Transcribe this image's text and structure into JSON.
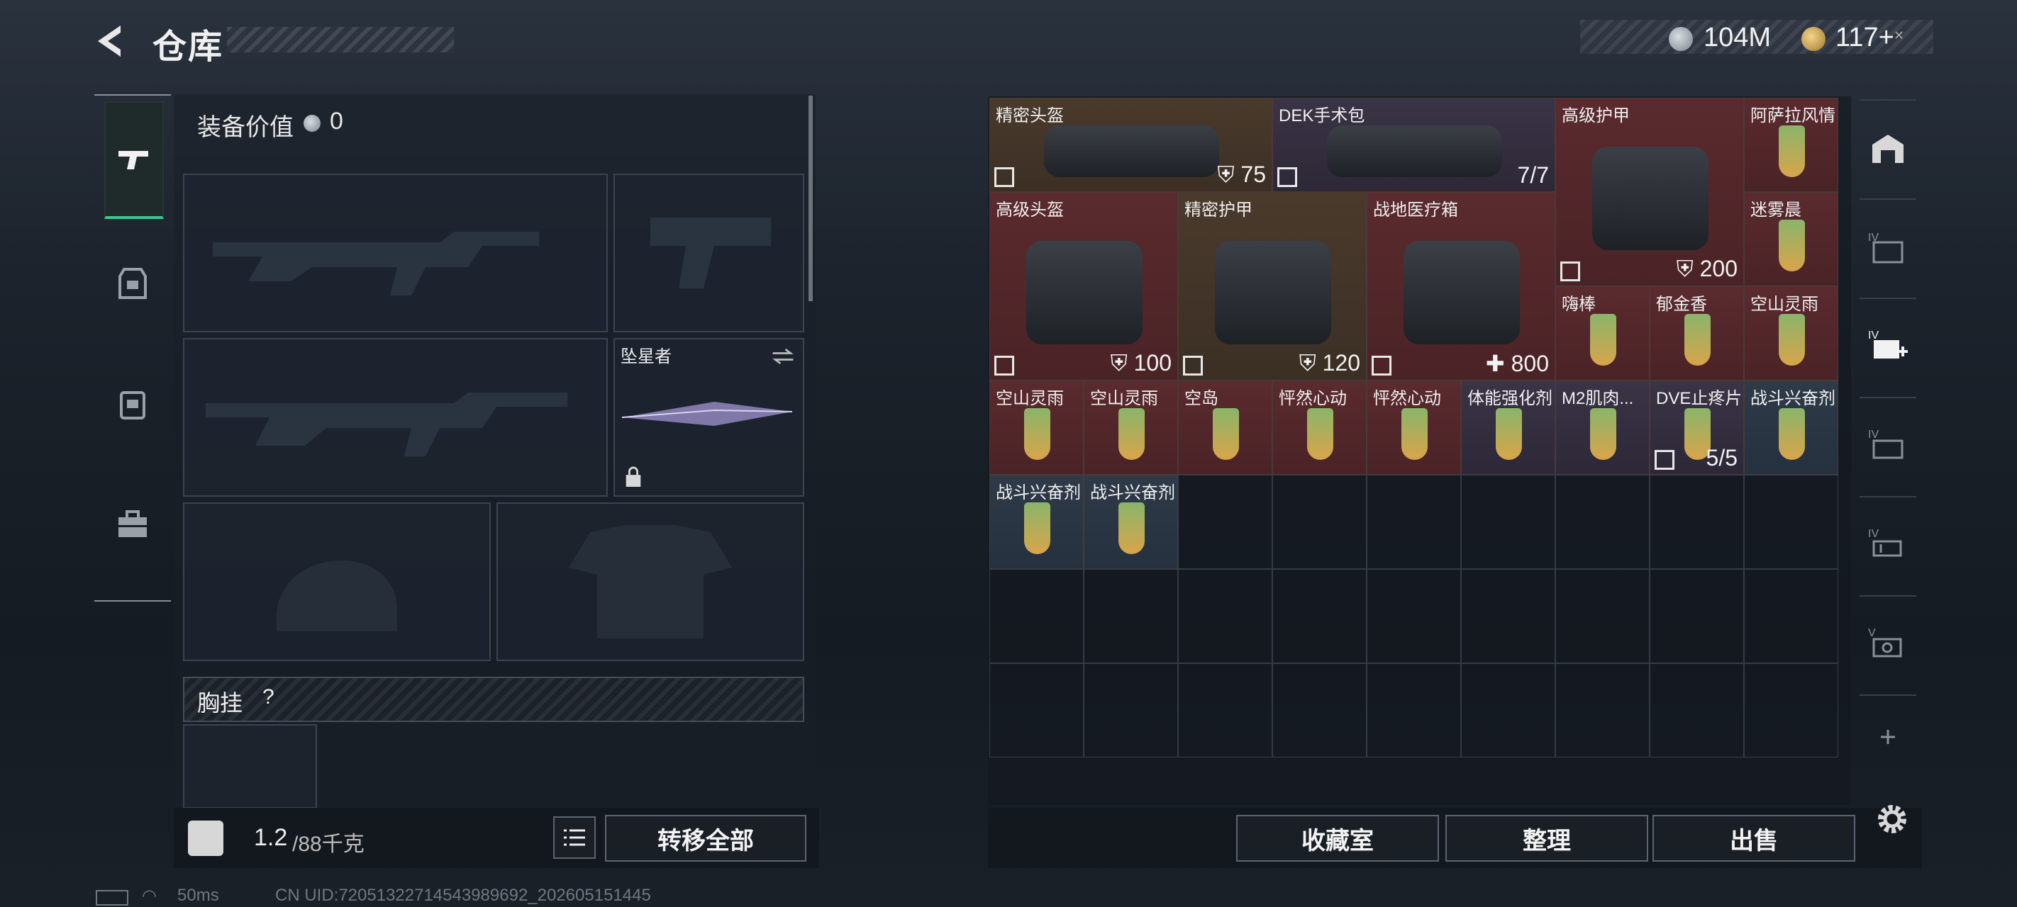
{
  "header": {
    "title": "仓库",
    "currency1": "104M",
    "currency2": "117+"
  },
  "left": {
    "equip_value_label": "装备价值",
    "equip_value": "0",
    "melee_name": "坠星者",
    "chest_label": "胸挂",
    "chest_help": "?",
    "weight": "1.2",
    "weight_max": "/88千克",
    "transfer_all": "转移全部"
  },
  "grid_items": [
    {
      "name": "精密头盔",
      "value": "75",
      "icon": "shield-icon",
      "color": "brown"
    },
    {
      "name": "DEK手术包",
      "value": "7/7",
      "icon": "",
      "color": "purple"
    },
    {
      "name": "高级护甲",
      "value": "200",
      "icon": "shield-icon",
      "color": "red"
    },
    {
      "name": "阿萨拉风情",
      "value": "",
      "icon": "",
      "color": "red"
    },
    {
      "name": "迷雾晨",
      "value": "",
      "icon": "",
      "color": "red"
    },
    {
      "name": "高级头盔",
      "value": "100",
      "icon": "shield-icon",
      "color": "red"
    },
    {
      "name": "精密护甲",
      "value": "120",
      "icon": "shield-icon",
      "color": "brown"
    },
    {
      "name": "战地医疗箱",
      "value": "800",
      "icon": "plus-icon",
      "color": "red"
    },
    {
      "name": "嗨棒",
      "value": "",
      "icon": "",
      "color": "red"
    },
    {
      "name": "郁金香",
      "value": "",
      "icon": "",
      "color": "red"
    },
    {
      "name": "空山灵雨",
      "value": "",
      "icon": "",
      "color": "red"
    },
    {
      "name": "空山灵雨",
      "value": "",
      "icon": "",
      "color": "red"
    },
    {
      "name": "空山灵雨",
      "value": "",
      "icon": "",
      "color": "red"
    },
    {
      "name": "空岛",
      "value": "",
      "icon": "",
      "color": "red"
    },
    {
      "name": "怦然心动",
      "value": "",
      "icon": "",
      "color": "red"
    },
    {
      "name": "怦然心动",
      "value": "",
      "icon": "",
      "color": "red"
    },
    {
      "name": "体能强化剂",
      "value": "",
      "icon": "",
      "color": "purple"
    },
    {
      "name": "M2肌肉...",
      "value": "",
      "icon": "",
      "color": "purple"
    },
    {
      "name": "DVE止疼片",
      "value": "5/5",
      "icon": "",
      "color": "purple"
    },
    {
      "name": "战斗兴奋剂",
      "value": "",
      "icon": "",
      "color": "blue"
    },
    {
      "name": "战斗兴奋剂",
      "value": "",
      "icon": "",
      "color": "blue"
    },
    {
      "name": "战斗兴奋剂",
      "value": "",
      "icon": "",
      "color": "blue"
    }
  ],
  "right_buttons": {
    "collection": "收藏室",
    "sort": "整理",
    "sell": "出售"
  },
  "footer": {
    "ping": "50ms",
    "uid": "CN UID:72051322714543989692_202605151445"
  }
}
